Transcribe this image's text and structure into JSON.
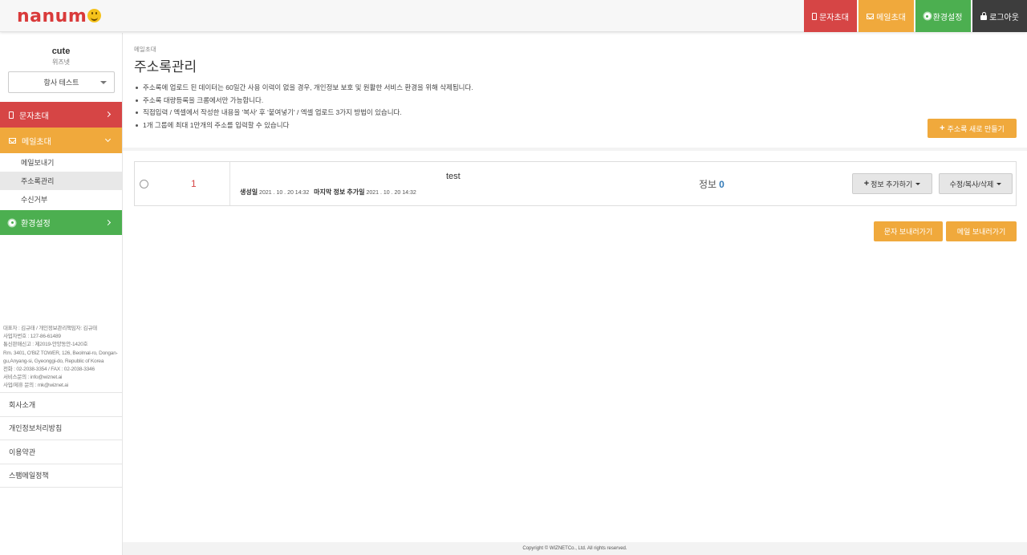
{
  "app": {
    "logo_text": "nanum",
    "colors": {
      "sms": "#d64545",
      "mail": "#f0a93c",
      "settings": "#4caf50",
      "logout": "#3d3d3d"
    }
  },
  "topnav": {
    "sms": {
      "label": "문자초대",
      "icon": "mobile-icon"
    },
    "mail": {
      "label": "메일초대",
      "icon": "envelope-icon"
    },
    "settings": {
      "label": "환경설정",
      "icon": "gear-icon"
    },
    "logout": {
      "label": "로그아웃",
      "icon": "lock-icon"
    }
  },
  "sidebar": {
    "user_name": "cute",
    "user_org": "위즈넷",
    "group_select": "항사 테스트",
    "menu_sms": "문자초대",
    "menu_mail": "메일초대",
    "mail_sub": [
      "메일보내기",
      "주소록관리",
      "수신거부"
    ],
    "menu_settings": "환경설정",
    "company_info": [
      "대표자 : 김규태 / 개인정보관리책임자: 김규태",
      "사업자번호 : 127-86-61489",
      "통신판매신고 : 제2019-안양동안-1420호",
      "Rm. 3401, O'BIZ TOWER, 126, Beolmal-ro, Dongan-gu,Anyang-si, Gyeonggi-do, Republic of Korea",
      "전화 : 02-2038-3354  /  FAX : 02-2038-3346",
      "서비스문의 : info@wiznet.ai",
      "사업/제휴 문의 : mk@wiznet.ai"
    ],
    "footer_links": [
      "회사소개",
      "개인정보처리방침",
      "이용약관",
      "스팸메일정책"
    ]
  },
  "main": {
    "breadcrumb": "메일초대",
    "title": "주소록관리",
    "notices": [
      "주소록에 업로드 된 데이터는 60일간 사용 이력이 없을 경우, 개인정보 보호 및 원활한 서비스 환경을 위해 삭제됩니다.",
      "주소록 대량등록을 크롬에서만 가능합니다.",
      "직접입력 / 엑셀에서 작성한 내용을 '복사' 후 '붙여넣기' / 엑셀 업로드 3가지 방법이 있습니다.",
      "1개 그룹에 최대 1만개의 주소를 입력할 수 있습니다"
    ],
    "new_button": "주소록 새로 만들기",
    "rows": [
      {
        "number": "1",
        "name": "test",
        "created_label": "생성일",
        "created_date": "2021 . 10 . 20 14:32",
        "last_added_label": "마지막 정보 추가일",
        "last_added_date": "2021 . 10 . 20 14:32",
        "info_label": "정보",
        "info_count": "0",
        "add_info_button": "정보 추가하기",
        "edit_button": "수정/복사/삭제"
      }
    ],
    "send_sms_button": "문자 보내러가기",
    "send_mail_button": "메일 보내러가기"
  },
  "footer": {
    "copyright": "Copyright © WIZNETCo., Ltd. All rights reserved."
  }
}
